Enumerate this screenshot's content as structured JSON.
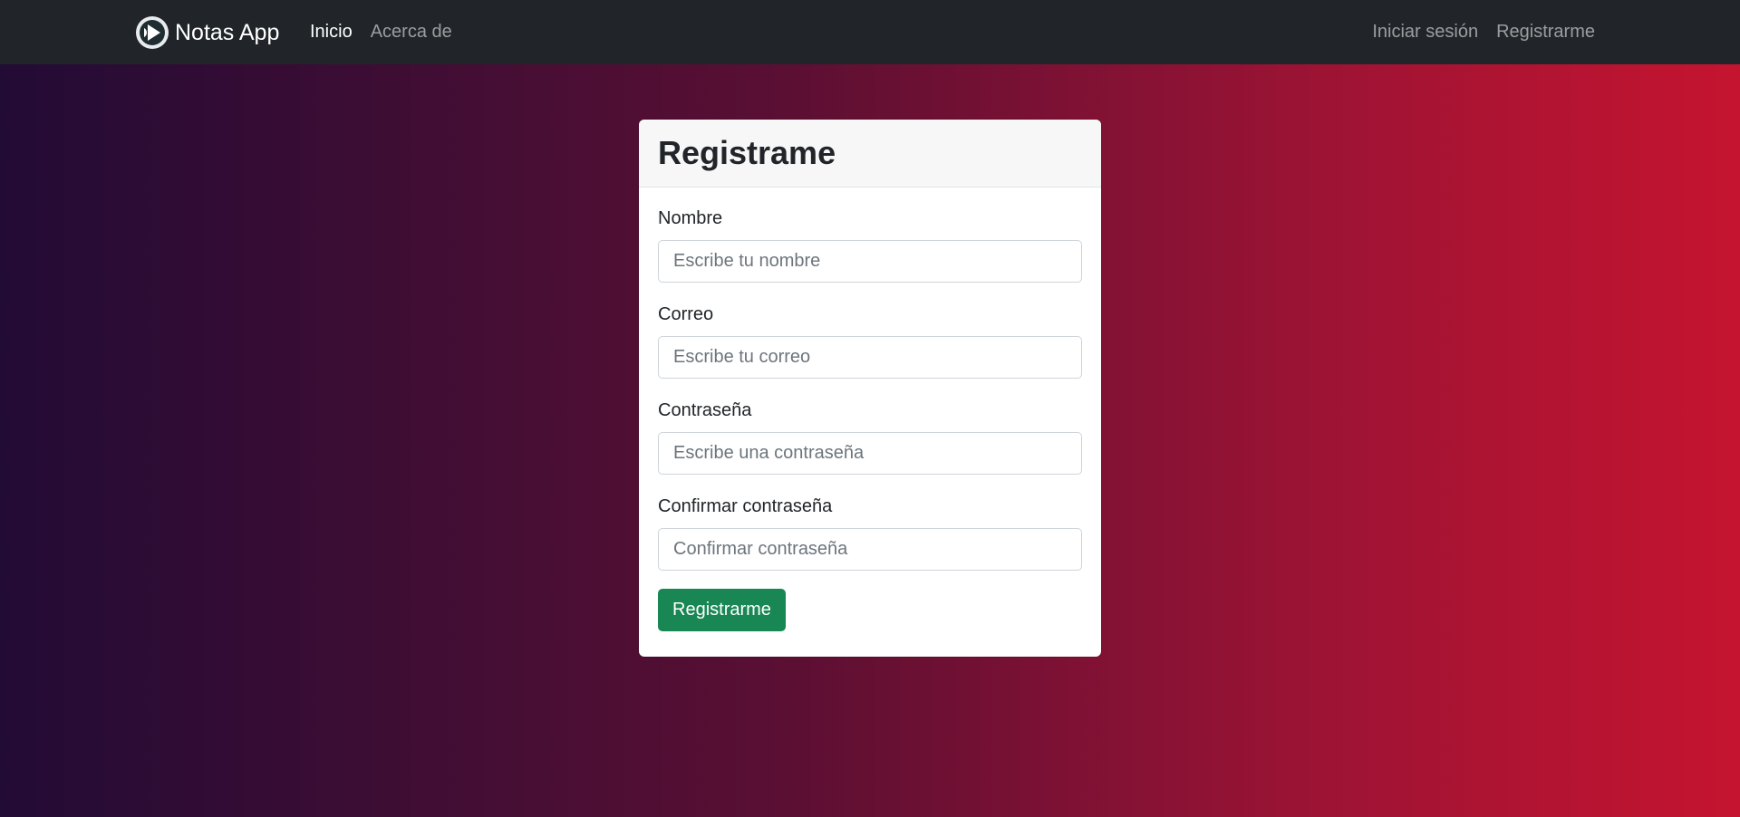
{
  "navbar": {
    "brand": {
      "icon": "app-logo-icon",
      "text": "Notas App"
    },
    "left_links": [
      {
        "label": "Inicio",
        "active": true
      },
      {
        "label": "Acerca de",
        "active": false
      }
    ],
    "right_links": [
      {
        "label": "Iniciar sesión"
      },
      {
        "label": "Registrarme"
      }
    ]
  },
  "form": {
    "title": "Registrame",
    "fields": [
      {
        "label": "Nombre",
        "placeholder": "Escribe tu nombre",
        "value": ""
      },
      {
        "label": "Correo",
        "placeholder": "Escribe tu correo",
        "value": ""
      },
      {
        "label": "Contraseña",
        "placeholder": "Escribe una contraseña",
        "value": ""
      },
      {
        "label": "Confirmar contraseña",
        "placeholder": "Confirmar contraseña",
        "value": ""
      }
    ],
    "submit_label": "Registrarme"
  },
  "colors": {
    "navbar_bg": "#212529",
    "gradient_start": "#220b35",
    "gradient_end": "#c51430",
    "submit_button": "#198754"
  }
}
